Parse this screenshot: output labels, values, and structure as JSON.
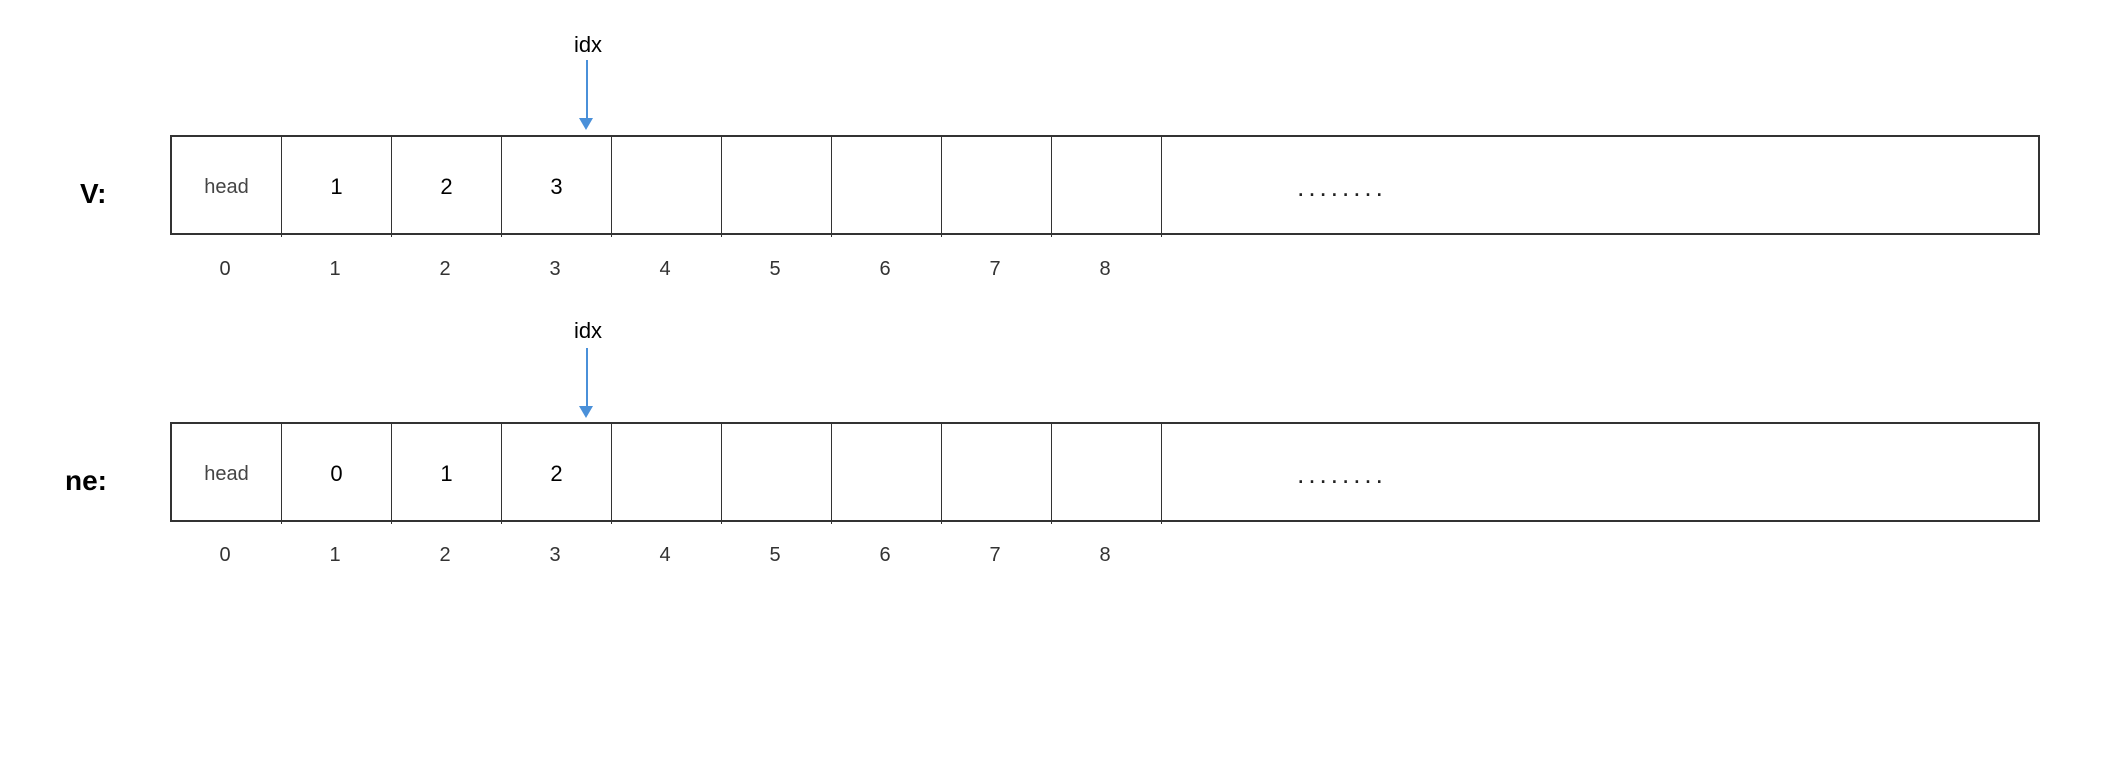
{
  "diagram": {
    "top": {
      "label": "V:",
      "idx_label": "idx",
      "cells": [
        "head",
        "1",
        "2",
        "3",
        "",
        "",
        "",
        "",
        "",
        "........"
      ],
      "indices": [
        "0",
        "1",
        "2",
        "3",
        "4",
        "5",
        "6",
        "7",
        "8",
        ""
      ]
    },
    "bottom": {
      "label": "ne:",
      "idx_label": "idx",
      "cells": [
        "head",
        "0",
        "1",
        "2",
        "",
        "",
        "",
        "",
        "",
        "........"
      ],
      "indices": [
        "0",
        "1",
        "2",
        "3",
        "4",
        "5",
        "6",
        "7",
        "8",
        ""
      ]
    }
  },
  "colors": {
    "arrow": "#4a90d9",
    "text": "#000000",
    "border": "#333333"
  }
}
